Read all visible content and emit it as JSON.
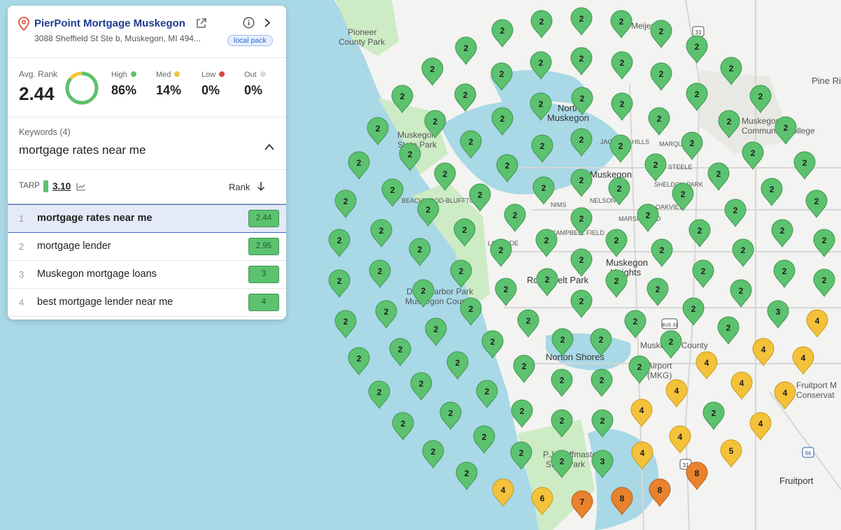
{
  "business": {
    "name": "PierPoint Mortgage Muskegon",
    "address": "3088 Sheffield St Ste b, Muskegon, MI 494...",
    "badge": "local pack"
  },
  "stats": {
    "avg_rank_label": "Avg. Rank",
    "avg_rank": "2.44",
    "donut_high_fraction": 0.86,
    "high": {
      "label": "High",
      "value": "86%",
      "color": "#5cc26f"
    },
    "med": {
      "label": "Med",
      "value": "14%",
      "color": "#f3c23a"
    },
    "low": {
      "label": "Low",
      "value": "0%",
      "color": "#e04545"
    },
    "out": {
      "label": "Out",
      "value": "0%",
      "color": "#d8d8d8"
    }
  },
  "keywords": {
    "label": "Keywords (4)",
    "selected": "mortgage rates near me",
    "tarp_label": "TARP",
    "tarp_value": "3.10",
    "rank_label": "Rank",
    "rows": [
      {
        "num": "1",
        "text": "mortgage rates near me",
        "rank": "2.44"
      },
      {
        "num": "2",
        "text": "mortgage lender",
        "rank": "2.95"
      },
      {
        "num": "3",
        "text": "Muskegon mortgage loans",
        "rank": "3"
      },
      {
        "num": "4",
        "text": "best mortgage lender near me",
        "rank": "4"
      }
    ]
  },
  "colors": {
    "rank2": "#5cc26f",
    "rank3": "#5cc26f",
    "rank4": "#f3c23a",
    "rank5": "#f3c23a",
    "rank6": "#f3c23a",
    "rank7": "#e8822c",
    "rank8": "#e8822c",
    "water": "#a9d8e6",
    "land": "#f3f3f1",
    "park": "#cdebc4"
  },
  "map_labels": [
    "Pioneer",
    "County Park",
    "Muskegon",
    "State Park",
    "North",
    "Muskegon",
    "Muskegon",
    "Muskegon",
    "Community College",
    "JACKSON HILLS",
    "MARQUETTE",
    "STEELE",
    "SHELDON PARK",
    "OAKVIEW",
    "NIMS",
    "NELSON",
    "MARSH FIELD",
    "CAMPBELL FIELD",
    "LAKESIDE",
    "BEACHWOOD-BLUFFTON",
    "Muskegon",
    "Heights",
    "Roosevelt Park",
    "Duck Harbor Park",
    "Muskegon County",
    "Norton Shores",
    "Muskegon County",
    "Airport",
    "(MKG)",
    "P.J. Hoffmaster",
    "State Park",
    "Fruitport",
    "Fruitport M",
    "Conservat",
    "Pine Ri",
    "Meijer",
    "31",
    "BUS 31",
    "31",
    "96"
  ],
  "grid_pins": [
    {
      "rank": "2"
    }
  ]
}
